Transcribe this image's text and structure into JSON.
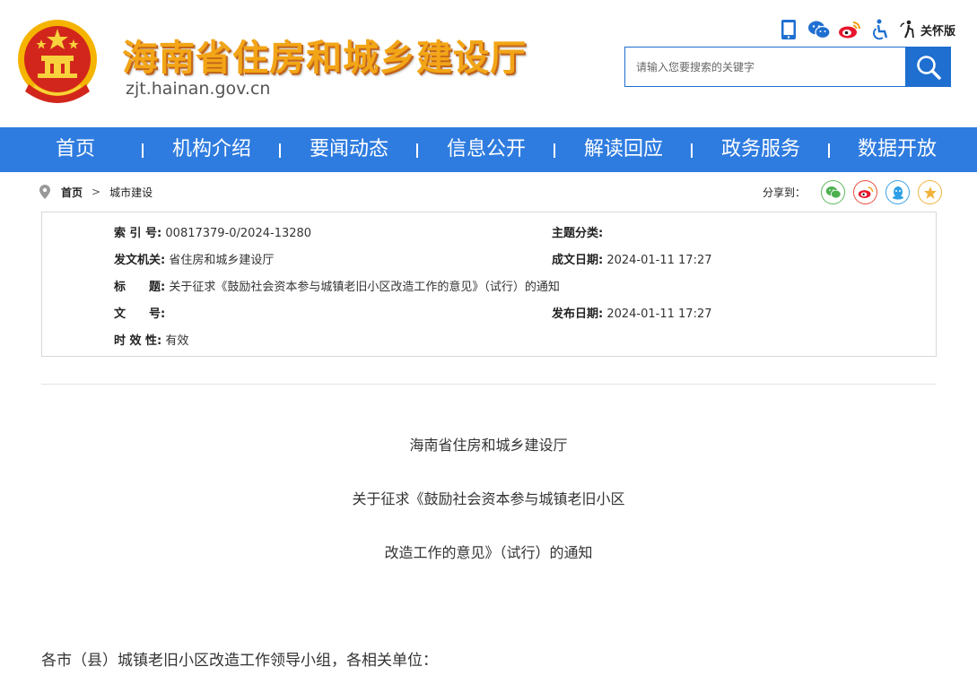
{
  "header": {
    "site_title": "海南省住房和城乡建设厅",
    "site_domain": "zjt.hainan.gov.cn",
    "elder_mode": "关怀版",
    "search_placeholder": "请输入您要搜索的关键字"
  },
  "icons": [
    "mobile-icon",
    "wechat-icon",
    "weibo-icon",
    "accessibility-icon",
    "elder-care-icon",
    "search-icon"
  ],
  "nav": [
    "首页",
    "机构介绍",
    "要闻动态",
    "信息公开",
    "解读回应",
    "政务服务",
    "数据开放"
  ],
  "breadcrumb": {
    "home": "首页",
    "arrow": ">",
    "current": "城市建设"
  },
  "share": {
    "label": "分享到："
  },
  "info": {
    "index_label": "索 引 号:",
    "index_value": "00817379-0/2024-13280",
    "topic_label": "主题分类:",
    "topic_value": "",
    "issuer_label": "发文机关:",
    "issuer_value": "省住房和城乡建设厅",
    "created_label": "成文日期:",
    "created_value": "2024-01-11 17:27",
    "title_label": "标　　题:",
    "title_value": "关于征求《鼓励社会资本参与城镇老旧小区改造工作的意见》（试行）的通知",
    "docno_label": "文　　号:",
    "docno_value": "",
    "published_label": "发布日期:",
    "published_value": "2024-01-11 17:27",
    "validity_label": "时 效 性:",
    "validity_value": "有效"
  },
  "article": {
    "org": "海南省住房和城乡建设厅",
    "title_line1": "关于征求《鼓励社会资本参与城镇老旧小区",
    "title_line2": "改造工作的意见》（试行）的通知",
    "salutation": "各市（县）城镇老旧小区改造工作领导小组，各相关单位："
  },
  "colors": {
    "nav_blue": "#2f7ce0",
    "search_blue": "#1e6fd0",
    "title_orange": "#f2a516"
  }
}
